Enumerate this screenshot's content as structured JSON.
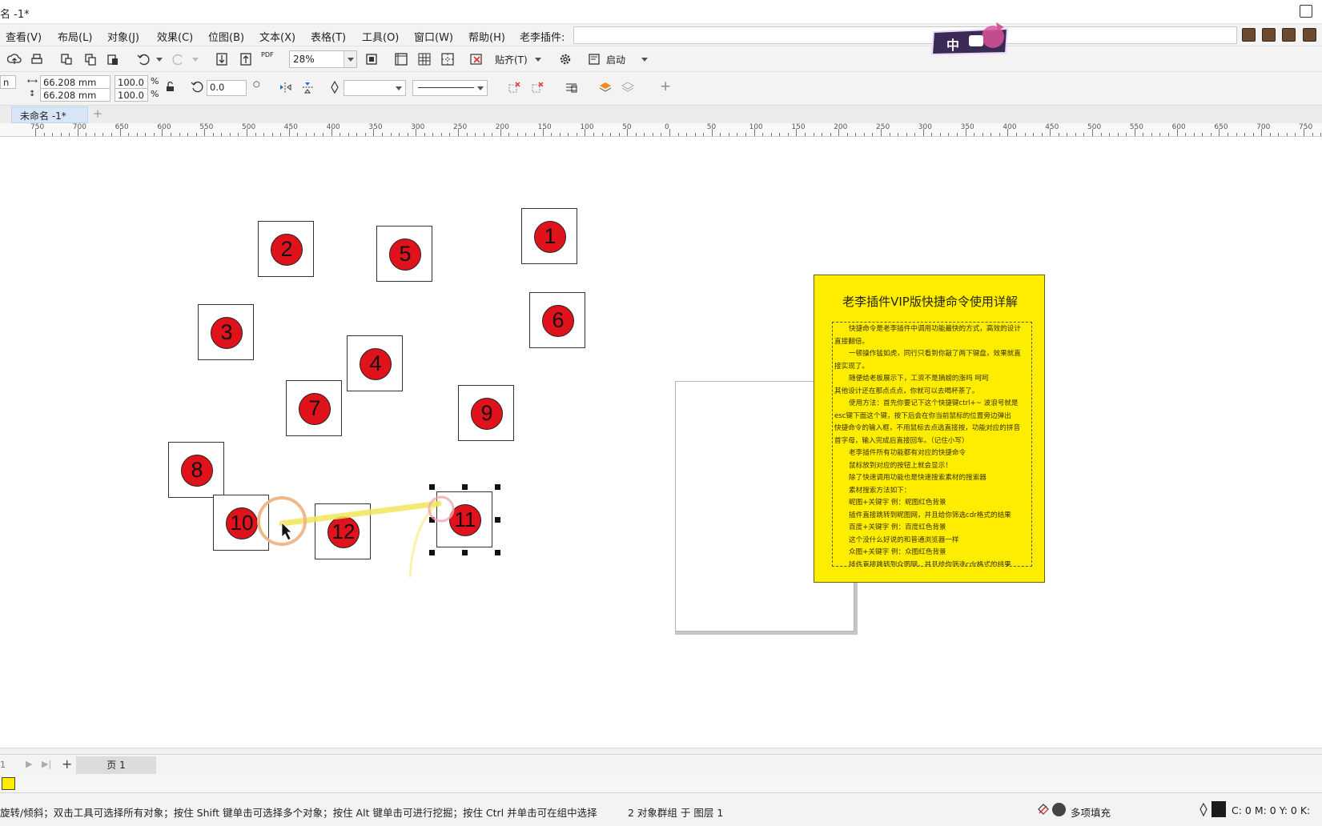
{
  "window": {
    "title": "名 -1*"
  },
  "menu": {
    "items": [
      "查看(V)",
      "布局(L)",
      "对象(J)",
      "效果(C)",
      "位图(B)",
      "文本(X)",
      "表格(T)",
      "工具(O)",
      "窗口(W)",
      "帮助(H)"
    ],
    "plugin_label": "老李插件:",
    "badge_label": "中"
  },
  "toolbar": {
    "zoom": "28%",
    "snap_label": "贴齐(T)",
    "launch_label": "启动",
    "pdf_label": "PDF"
  },
  "properties": {
    "x_value": "n",
    "width": "66.208 mm",
    "height": "66.208 mm",
    "scale_x": "100.0",
    "scale_y": "100.0",
    "percent": "%",
    "rotation": "0.0"
  },
  "document": {
    "tab_label": "未命名 -1*"
  },
  "ruler": {
    "labels": [
      "750",
      "700",
      "650",
      "600",
      "550",
      "500",
      "450",
      "400",
      "350",
      "300",
      "250",
      "200",
      "150",
      "100",
      "50",
      "0",
      "50",
      "100",
      "150",
      "200",
      "250",
      "300",
      "350",
      "400",
      "450",
      "500",
      "550",
      "600",
      "650",
      "700",
      "750"
    ]
  },
  "canvas": {
    "numbered_boxes": [
      "1",
      "2",
      "3",
      "4",
      "5",
      "6",
      "7",
      "8",
      "9",
      "10",
      "11",
      "12"
    ],
    "card": {
      "title": "老李插件VIP版快捷命令使用详解",
      "lines": [
        "快捷命令是老李插件中调用功能最快的方式，高效的设计",
        "直接翻倍。",
        "一顿操作猛如虎，同行只看到你敲了两下键盘，效果就直",
        "接实现了。",
        "随便给老板展示下，工资不是摘螃的涨吗 呵呵",
        "其他设计还在那点点点，你就可以去喝杯茶了。",
        "使用方法：首先你要记下这个快捷键ctrl+~ 波浪号就是",
        "esc键下面这个键，按下后会在你当前鼠标的位置旁边弹出",
        "快捷命令的输入框，不用鼠标去点选直接按，功能对应的拼音",
        "首字母，输入完成后直接回车。（记住小写）",
        "老李插件所有功能都有对应的快捷命令",
        "鼠标放到对应的按钮上就会显示！",
        "除了快速调用功能也是快速搜索素材的搜索器",
        "素材搜索方法如下：",
        "昵图+关键字  例：昵图红色背景",
        "插件直接跳转到昵图网，并且给你筛选cdr格式的结果",
        "百度+关键字  例：百度红色背景",
        "这个没什么好说的和普通浏览器一样",
        "众图+关键字  例：众图红色背景",
        "插件直接跳转到众图网，并且给你筛选cdr格式的结果"
      ]
    }
  },
  "pagebar": {
    "page_count": "1",
    "page_tab": "页 1"
  },
  "status": {
    "hint": "旋转/倾斜；双击工具可选择所有对象；按住 Shift 键单击可选择多个对象；按住 Alt 键单击可进行挖掘；按住 Ctrl 并单击可在组中选择",
    "selection": "2 对象群组 于 图层 1",
    "fill": "多项填充",
    "cmyk": "C: 0 M: 0 Y: 0 K:"
  },
  "colors": {
    "accent_red": "#e0121b",
    "card_yellow": "#ffed00"
  }
}
